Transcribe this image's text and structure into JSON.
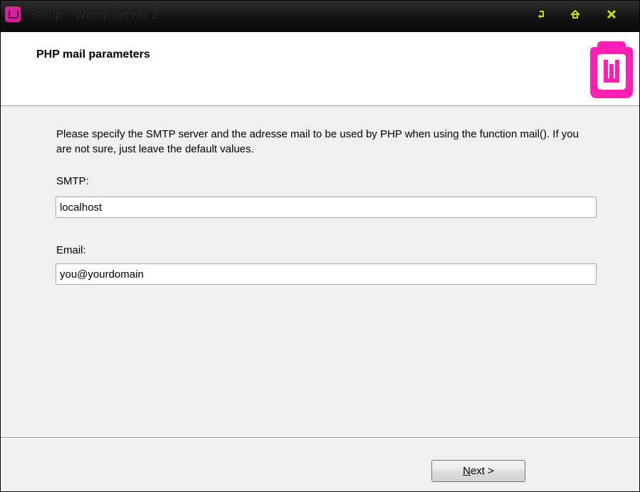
{
  "window": {
    "title": "Setup - WampServer 2"
  },
  "header": {
    "title": "PHP mail parameters"
  },
  "main": {
    "description": "Please specify the SMTP server and the adresse mail to be used by PHP when using the function mail(). If you are not sure, just leave the default values.",
    "smtp_label": "SMTP:",
    "smtp_value": "localhost",
    "email_label": "Email:",
    "email_value": "you@yourdomain"
  },
  "footer": {
    "next_mnemonic": "N",
    "next_rest": "ext >"
  },
  "colors": {
    "accent": "#ff1fb4",
    "titlebar": "#141414",
    "titlebar_buttons": "#c6e000"
  },
  "icons": {
    "app": "wampserver-app-icon",
    "minimize": "minimize-icon",
    "restore": "home-icon",
    "close": "close-icon",
    "logo": "wampserver-logo"
  }
}
